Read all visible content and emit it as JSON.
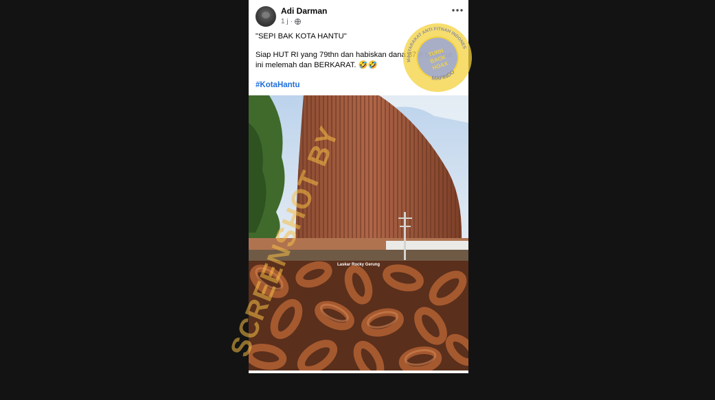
{
  "post": {
    "author": "Adi Darman",
    "time": "1 j",
    "caption_line1": "\"SEPI BAK KOTA HANTU\"",
    "caption_line2": "Siap HUT RI yang 79thn dan habiskan dana 87M besi tua ini melemah dan BERKARAT. 🤣🤣",
    "hashtag": "#KotaHantu",
    "image2_label": "Laskar Rocky Gerung"
  },
  "stamp": {
    "outer_text": "MASYARAKAT ANTI FITNAH INDONESIA · MAFINDO",
    "center_text": "TURN BACK HOAX"
  },
  "watermark": {
    "text": "SCREENSHOT BY"
  },
  "icons": {
    "avatar": "avatar",
    "privacy": "globe-icon",
    "menu": "more-options-icon"
  },
  "colors": {
    "background": "#131313",
    "link": "#216fdb",
    "stamp_outer": "#f3d23e",
    "stamp_inner": "#9aa6d6",
    "watermark": "#f6be46"
  }
}
